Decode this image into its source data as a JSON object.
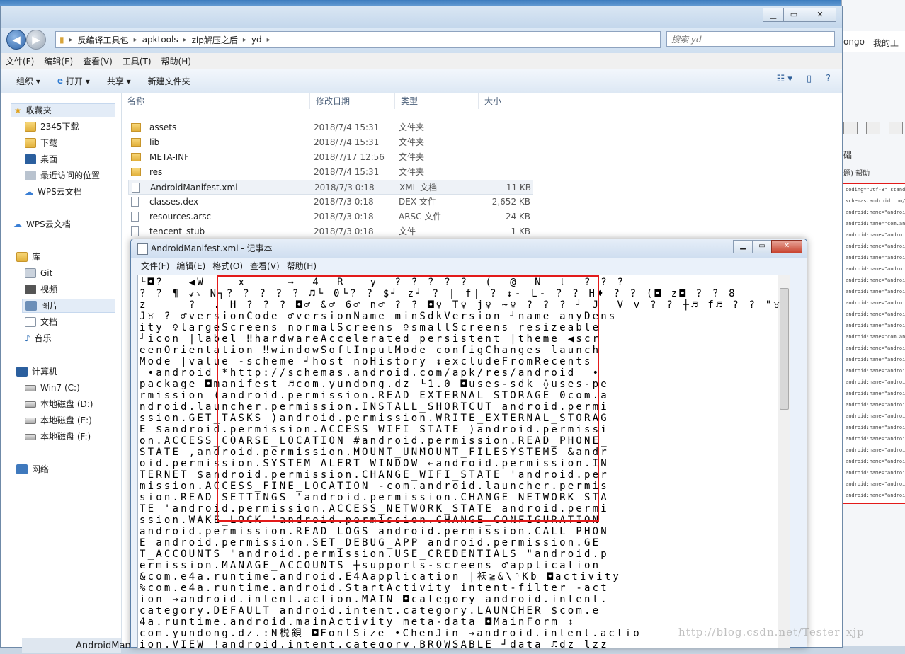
{
  "explorer": {
    "breadcrumb": [
      "反编译工具包",
      "apktools",
      "zip解压之后",
      "yd"
    ],
    "search_placeholder": "搜索 yd",
    "menu": [
      "文件(F)",
      "编辑(E)",
      "查看(V)",
      "工具(T)",
      "帮助(H)"
    ],
    "commands": {
      "organize": "组织 ▾",
      "open": "打开 ▾",
      "share": "共享 ▾",
      "new_folder": "新建文件夹"
    },
    "columns": {
      "name": "名称",
      "date": "修改日期",
      "type": "类型",
      "size": "大小"
    },
    "files": [
      {
        "name": "assets",
        "date": "2018/7/4 15:31",
        "type": "文件夹",
        "size": "",
        "icon": "folder"
      },
      {
        "name": "lib",
        "date": "2018/7/4 15:31",
        "type": "文件夹",
        "size": "",
        "icon": "folder"
      },
      {
        "name": "META-INF",
        "date": "2018/7/17 12:56",
        "type": "文件夹",
        "size": "",
        "icon": "folder"
      },
      {
        "name": "res",
        "date": "2018/7/4 15:31",
        "type": "文件夹",
        "size": "",
        "icon": "folder"
      },
      {
        "name": "AndroidManifest.xml",
        "date": "2018/7/3 0:18",
        "type": "XML 文档",
        "size": "11 KB",
        "icon": "xml"
      },
      {
        "name": "classes.dex",
        "date": "2018/7/3 0:18",
        "type": "DEX 文件",
        "size": "2,652 KB",
        "icon": "file"
      },
      {
        "name": "resources.arsc",
        "date": "2018/7/3 0:18",
        "type": "ARSC 文件",
        "size": "24 KB",
        "icon": "file"
      },
      {
        "name": "tencent_stub",
        "date": "2018/7/3 0:18",
        "type": "文件",
        "size": "1 KB",
        "icon": "file"
      }
    ],
    "nav": {
      "favorites": "收藏夹",
      "fav_items": [
        "2345下载",
        "下载",
        "桌面",
        "最近访问的位置",
        "WPS云文档"
      ],
      "wps": "WPS云文档",
      "library": "库",
      "lib_items": [
        "Git",
        "视频",
        "图片",
        "文档",
        "音乐"
      ],
      "computer": "计算机",
      "drives": [
        "Win7 (C:)",
        "本地磁盘 (D:)",
        "本地磁盘 (E:)",
        "本地磁盘 (F:)"
      ],
      "network": "网络"
    }
  },
  "notepad": {
    "title": "AndroidManifest.xml - 记事本",
    "menu": [
      "文件(F)",
      "编辑(E)",
      "格式(O)",
      "查看(V)",
      "帮助(H)"
    ],
    "lines": [
      "└◘?   ◀W    x     →  4  R   y  ? ? ? ? ?  (  @  N  t  ? ? ?",
      "? ? ¶ ⤺ N┐? ? ? ? ? ♬└ 0└? ? $┘ z┘ ? | f| ? ↕- L- ? ? H♦ ? ? (◘ z◘ ? ? 8",
      "z     ?  . H ? ? ? ◘♂ &♂ 6♂ n♂ ? ? ◘♀ T♀ j♀ ~♀ ? ? ? ┘ J  V v ? ? ┼♬ f♬ ? ? \"♉",
      "J♉ ? ♂versionCode ♂versionName minSdkVersion ┘name anyDens",
      "ity ♀largeScreens normalScreens ♀smallScreens resizeable",
      "┘icon |label ‼hardwareAccelerated persistent |theme ◀scr",
      "eenOrientation ‼windowSoftInputMode configChanges launch",
      "Mode |value -scheme ┘host noHistory ↕excludeFromRecents",
      " •android *http://schemas.android.com/apk/res/android  •",
      "package ◘manifest ♬com.yundong.dz └1.0 ◘uses-sdk ◊uses-pe",
      "rmission (android.permission.READ_EXTERNAL_STORAGE 0com.a",
      "ndroid.launcher.permission.INSTALL_SHORTCUT android.permi",
      "ssion.GET_TASKS )android.permission.WRITE_EXTERNAL_STORAG",
      "E $android.permission.ACCESS_WIFI_STATE )android.permissi",
      "on.ACCESS_COARSE_LOCATION #android.permission.READ_PHONE_",
      "STATE ,android.permission.MOUNT_UNMOUNT_FILESYSTEMS &andr",
      "oid.permission.SYSTEM_ALERT_WINDOW ←android.permission.IN",
      "TERNET $android.permission.CHANGE_WIFI_STATE 'android.per",
      "mission.ACCESS_FINE_LOCATION -com.android.launcher.permis",
      "sion.READ_SETTINGS 'android.permission.CHANGE_NETWORK_STA",
      "TE 'android.permission.ACCESS_NETWORK_STATE android.permi",
      "ssion.WAKE_LOCK 'android.permission.CHANGE_CONFIGURATION",
      "android.permission.READ_LOGS android.permission.CALL_PHON",
      "E android.permission.SET_DEBUG_APP android.permission.GE",
      "T_ACCOUNTS \"android.permission.USE_CREDENTIALS \"android.p",
      "ermission.MANAGE_ACCOUNTS ┼supports-screens ♂application",
      "&com.e4a.runtime.android.E4Aapplication |祆≧&\\ⁿKb ◘activity",
      "%com.e4a.runtime.android.StartActivity intent-filter -act",
      "ion →android.intent.action.MAIN ◘category android.intent.",
      "category.DEFAULT android.intent.category.LAUNCHER $com.e",
      "4a.runtime.android.mainActivity meta-data ◘MainForm ↕",
      "com.yundong.dz.:N棁鋇 ◘FontSize •ChenJin →android.intent.actio",
      "ion.VIEW !android.intent.category.BROWSABLE ┘data ♬dz lzz"
    ]
  },
  "right_panel": {
    "text1": "ongo",
    "text2": "我的工",
    "text3": "础",
    "text4": "题) 帮助",
    "lines": [
      "coding=\"utf-8\" standal",
      "schemas.android.com/ap",
      "android:name=\"android.p",
      "android:name=\"com.andro",
      "android:name=\"android.p",
      "android:name=\"android.p",
      "android:name=\"android.p",
      "android:name=\"android.p",
      "android:name=\"android.p",
      "android:name=\"android.p",
      "android:name=\"android.p",
      "android:name=\"android.p",
      "android:name=\"android.p",
      "android:name=\"com.andro",
      "android:name=\"android.p",
      "android:name=\"android.p",
      "android:name=\"android.p",
      "android:name=\"android.p",
      "android:name=\"android.p",
      "android:name=\"android.p",
      "android:name=\"android.p",
      "android:name=\"android.p",
      "android:name=\"android.p",
      "android:name=\"android.p",
      "android:name=\"android.p",
      "android:name=\"android.p",
      "android:name=\"android.p",
      "android:name=\"android.p"
    ]
  },
  "taskbar": {
    "label": "AndroidMan"
  },
  "watermark": "http://blog.csdn.net/Tester_xjp"
}
